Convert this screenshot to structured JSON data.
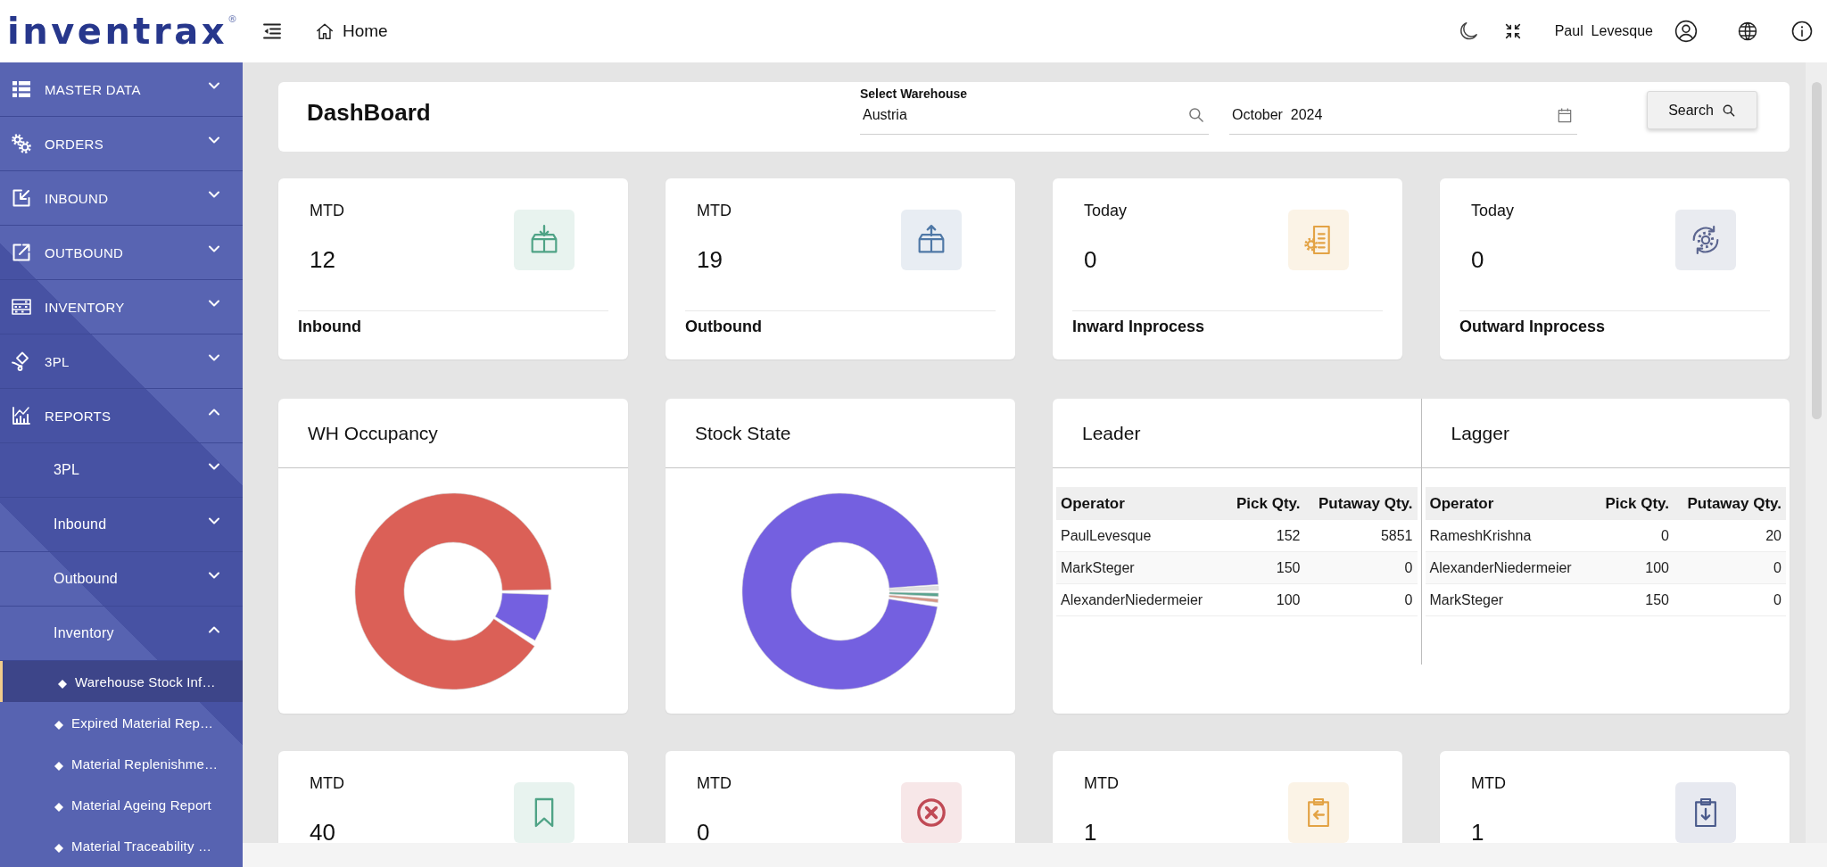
{
  "header": {
    "logo": "inventrax$^{®}$",
    "breadcrumb": "Home",
    "user_name": "Paul  Levesque"
  },
  "sidebar": {
    "items": [
      {
        "label": "MASTER DATA",
        "expanded": false
      },
      {
        "label": "ORDERS",
        "expanded": false
      },
      {
        "label": "INBOUND",
        "expanded": false
      },
      {
        "label": "OUTBOUND",
        "expanded": false
      },
      {
        "label": "INVENTORY",
        "expanded": false
      },
      {
        "label": "3PL",
        "expanded": false
      },
      {
        "label": "REPORTS",
        "expanded": true,
        "children": [
          {
            "label": "3PL",
            "expanded": false
          },
          {
            "label": "Inbound",
            "expanded": false
          },
          {
            "label": "Outbound",
            "expanded": false
          },
          {
            "label": "Inventory",
            "expanded": true,
            "children": [
              {
                "label": "Warehouse Stock Inf…",
                "selected": true
              },
              {
                "label": "Expired Material Rep…",
                "selected": false
              },
              {
                "label": "Material Replenishme…",
                "selected": false
              },
              {
                "label": "Material Ageing Report",
                "selected": false
              },
              {
                "label": "Material Traceability …",
                "selected": false
              }
            ]
          }
        ]
      }
    ]
  },
  "dashboard": {
    "title": "DashBoard",
    "warehouse_field": {
      "label": "Select Warehouse",
      "value": "Austria"
    },
    "period_field": {
      "value": "October  2024"
    },
    "search_button": "Search"
  },
  "stat_cards": [
    {
      "period": "MTD",
      "value": "12",
      "label": "Inbound",
      "color": "#4fa386"
    },
    {
      "period": "MTD",
      "value": "19",
      "label": "Outbound",
      "color": "#4f78a6"
    },
    {
      "period": "Today",
      "value": "0",
      "label": "Inward Inprocess",
      "color": "#e3a345"
    },
    {
      "period": "Today",
      "value": "0",
      "label": "Outward Inprocess",
      "color": "#5c6690"
    }
  ],
  "charts": [
    {
      "title": "WH Occupancy"
    },
    {
      "title": "Stock State"
    }
  ],
  "leaderboards": [
    {
      "title": "Leader",
      "columns": [
        "Operator",
        "Pick Qty.",
        "Putaway Qty."
      ],
      "rows": [
        [
          "PaulLevesque",
          "152",
          "5851"
        ],
        [
          "MarkSteger",
          "150",
          "0"
        ],
        [
          "AlexanderNiedermeier",
          "100",
          "0"
        ]
      ]
    },
    {
      "title": "Lagger",
      "columns": [
        "Operator",
        "Pick Qty.",
        "Putaway Qty."
      ],
      "rows": [
        [
          "RameshKrishna",
          "0",
          "20"
        ],
        [
          "AlexanderNiedermeier",
          "100",
          "0"
        ],
        [
          "MarkSteger",
          "150",
          "0"
        ]
      ]
    }
  ],
  "bottom_cards": [
    {
      "period": "MTD",
      "value": "40",
      "color": "#4fa386"
    },
    {
      "period": "MTD",
      "value": "0",
      "color": "#c04a55"
    },
    {
      "period": "MTD",
      "value": "1",
      "color": "#e3a345"
    },
    {
      "period": "MTD",
      "value": "1",
      "color": "#4b5b8c"
    }
  ]
}
